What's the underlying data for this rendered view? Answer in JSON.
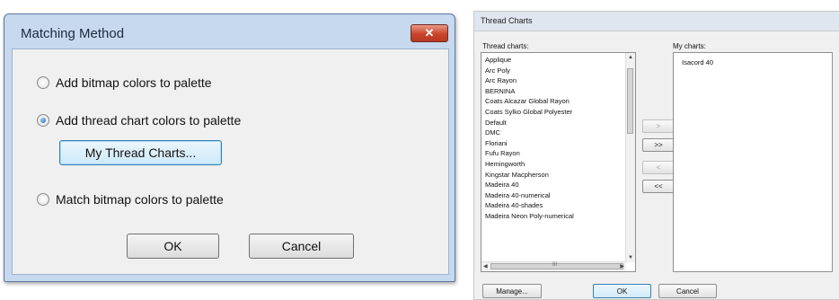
{
  "matching_dialog": {
    "title": "Matching Method",
    "close_label": "✕",
    "options": [
      {
        "label": "Add bitmap colors to palette",
        "selected": false
      },
      {
        "label": "Add thread chart colors to palette",
        "selected": true
      },
      {
        "label": "Match bitmap colors to palette",
        "selected": false
      }
    ],
    "my_thread_charts_label": "My Thread Charts...",
    "ok_label": "OK",
    "cancel_label": "Cancel"
  },
  "thread_dialog": {
    "title": "Thread Charts",
    "thread_charts_label": "Thread charts:",
    "my_charts_label": "My charts:",
    "thread_charts": [
      "Applique",
      "Arc Poly",
      "Arc Rayon",
      "BERNINA",
      "Coats Alcazar Global Rayon",
      "Coats Sylko Global Polyester",
      "Default",
      "DMC",
      "Floriani",
      "Fufu Rayon",
      "Hemingworth",
      "Kingstar Macpherson",
      "Madeira 40",
      "Madeira 40-numerical",
      "Madeira 40-shades",
      "Madeira Neon Poly-numerical"
    ],
    "my_charts": [
      "Isacord 40"
    ],
    "add_label": ">",
    "add_all_label": ">>",
    "remove_label": "<",
    "remove_all_label": "<<",
    "scroll_thumb_grip": "III",
    "manage_label": "Manage...",
    "ok_label": "OK",
    "cancel_label": "Cancel"
  }
}
